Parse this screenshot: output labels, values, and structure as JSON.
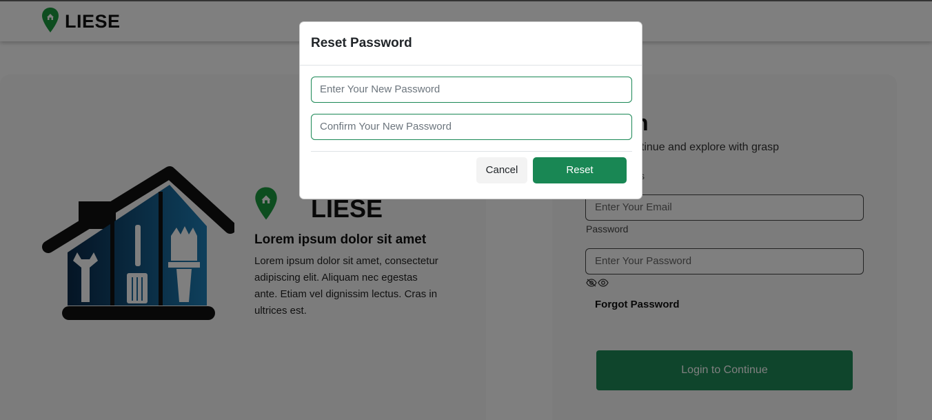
{
  "header": {
    "brand": "LIESE",
    "logo_icon": "map-pin-home-icon"
  },
  "about": {
    "brand": "LIESE",
    "title": "Lorem ipsum dolor sit amet",
    "body": "Lorem ipsum dolor sit amet, consectetur adipiscing elit. Aliquam nec egestas ante. Etiam vel dignissim lectus. Cras in ultrices est."
  },
  "login": {
    "title": "n",
    "subtitle": "ntinue and explore with grasp",
    "email_label": "ss",
    "email_placeholder": "Enter Your Email",
    "password_label": "Password",
    "password_placeholder": "Enter Your Password",
    "forgot": "Forgot Password",
    "submit": "Login to Continue",
    "toggle_icons": [
      "eye-slash-icon",
      "eye-icon"
    ]
  },
  "modal": {
    "title": "Reset Password",
    "new_password_placeholder": "Enter Your New Password",
    "confirm_password_placeholder": "Confirm Your New Password",
    "cancel": "Cancel",
    "reset": "Reset"
  },
  "colors": {
    "brand_green": "#198754",
    "pin_green": "#1a9a3f",
    "backdrop": "rgba(0,0,0,0.5)"
  }
}
